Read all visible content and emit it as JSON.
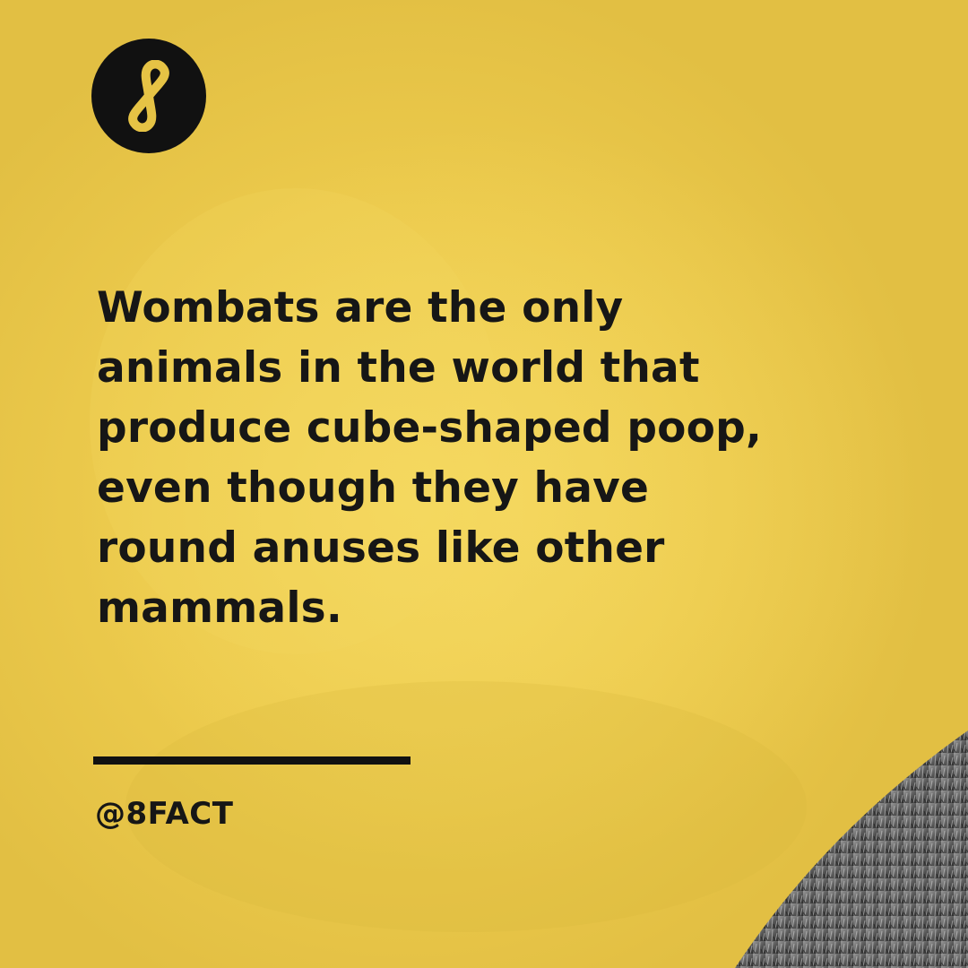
{
  "fact": {
    "lines": [
      "Wombats are the only",
      "animals in the world that",
      "produce cube-shaped poop,",
      "even though they have",
      "round anuses like other",
      "mammals."
    ]
  },
  "footer": {
    "handle": "@8FACT"
  },
  "brand": {
    "logo_icon": "infinity-eight-icon",
    "logo_bg": "#111111",
    "logo_fg": "#e6c345"
  },
  "colors": {
    "background_yellow": "#e6c345",
    "text": "#161616",
    "photo_gray": "#7a7a7a"
  }
}
